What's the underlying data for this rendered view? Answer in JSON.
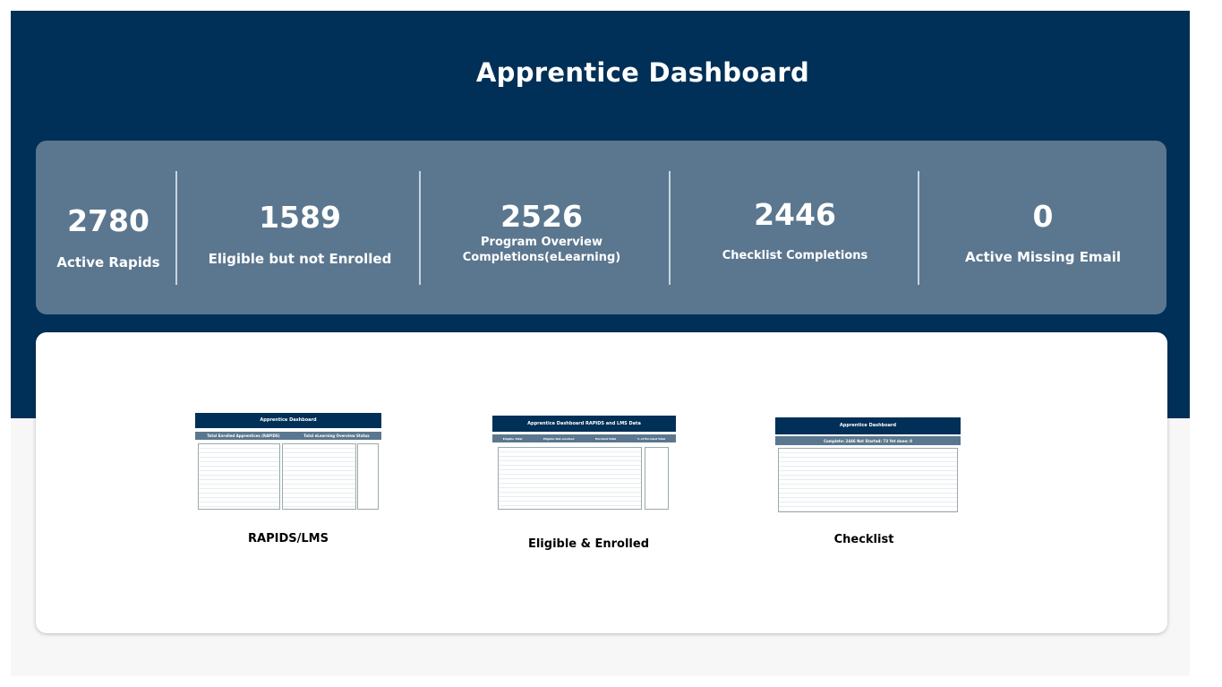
{
  "header": {
    "title": "Apprentice Dashboard"
  },
  "kpis": [
    {
      "value": "2780",
      "label": "Active Rapids"
    },
    {
      "value": "1589",
      "label": "Eligible but not Enrolled"
    },
    {
      "value": "2526",
      "label_line1": "Program Overview",
      "label_line2": "Completions(eLearning)"
    },
    {
      "value": "2446",
      "label": "Checklist Completions"
    },
    {
      "value": "0",
      "label": "Active Missing Email"
    }
  ],
  "reports": [
    {
      "title": "RAPIDS/LMS",
      "thumb_title": "Apprentice Dashboard",
      "thumb_tabs": [
        "Total Enrolled Apprentices (RAPIDS)",
        "Total eLearning Overview Status"
      ]
    },
    {
      "title": "Eligible & Enrolled",
      "thumb_title": "Apprentice Dashboard RAPIDS and LMS Data",
      "thumb_tabs": [
        "Eligible Total",
        "Eligible Not enrolled",
        "Enrolled Total",
        "% of Enrolled Total"
      ]
    },
    {
      "title": "Checklist",
      "thumb_title": "Apprentice Dashboard",
      "thumb_tabs": [
        "Complete: 2446 Not Started: 73 Yet done: 0"
      ]
    }
  ],
  "colors": {
    "banner": "#003057",
    "kpi_panel": "#5b778f",
    "card": "#ffffff"
  }
}
